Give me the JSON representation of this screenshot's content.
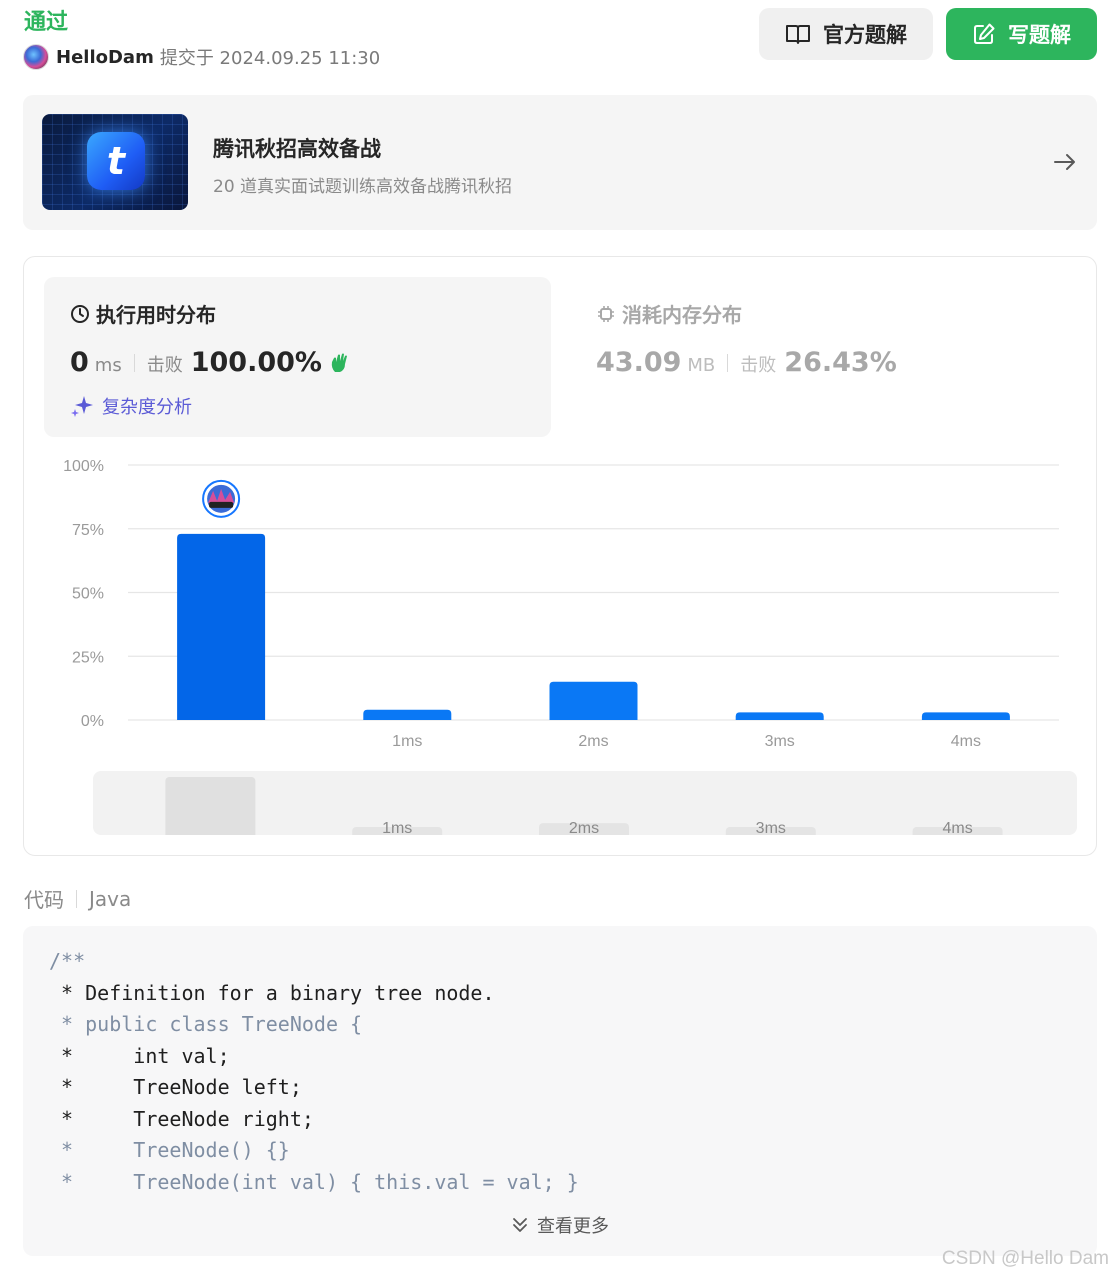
{
  "header": {
    "status": "通过",
    "user": "HelloDam",
    "submit_text": "提交于 2024.09.25 11:30",
    "official_solution_label": "官方题解",
    "write_solution_label": "写题解"
  },
  "promo": {
    "title": "腾讯秋招高效备战",
    "subtitle": "20 道真实面试题训练高效备战腾讯秋招"
  },
  "runtime": {
    "title": "执行用时分布",
    "value": "0",
    "unit": "ms",
    "beat_label": "击败",
    "beat_value": "100.00%",
    "analysis_label": "复杂度分析"
  },
  "memory": {
    "title": "消耗内存分布",
    "value": "43.09",
    "unit": "MB",
    "beat_label": "击败",
    "beat_value": "26.43%"
  },
  "chart_data": {
    "type": "bar",
    "categories": [
      "",
      "1ms",
      "2ms",
      "3ms",
      "4ms"
    ],
    "values": [
      73,
      4,
      15,
      3,
      3
    ],
    "yticks": [
      "100%",
      "75%",
      "50%",
      "25%",
      "0%"
    ],
    "ylim": [
      0,
      100
    ],
    "highlight_index": 0,
    "bar_color": "#0366e8",
    "grid": true
  },
  "code": {
    "label": "代码",
    "language": "Java",
    "lines": [
      {
        "text": "/**",
        "tone": "gray"
      },
      {
        "text": " * Definition for a binary tree node.",
        "tone": "dark"
      },
      {
        "text": " * public class TreeNode {",
        "tone": "gray"
      },
      {
        "text": " *     int val;",
        "tone": "dark"
      },
      {
        "text": " *     TreeNode left;",
        "tone": "dark"
      },
      {
        "text": " *     TreeNode right;",
        "tone": "dark"
      },
      {
        "text": " *     TreeNode() {}",
        "tone": "gray"
      },
      {
        "text": " *     TreeNode(int val) { this.val = val; }",
        "tone": "gray"
      }
    ],
    "more_label": "查看更多"
  },
  "watermark": "CSDN @Hello Dam",
  "colors": {
    "accent_green": "#2db55d",
    "bar_blue": "#0366e8",
    "analysis_purple": "#5b5bd6"
  }
}
